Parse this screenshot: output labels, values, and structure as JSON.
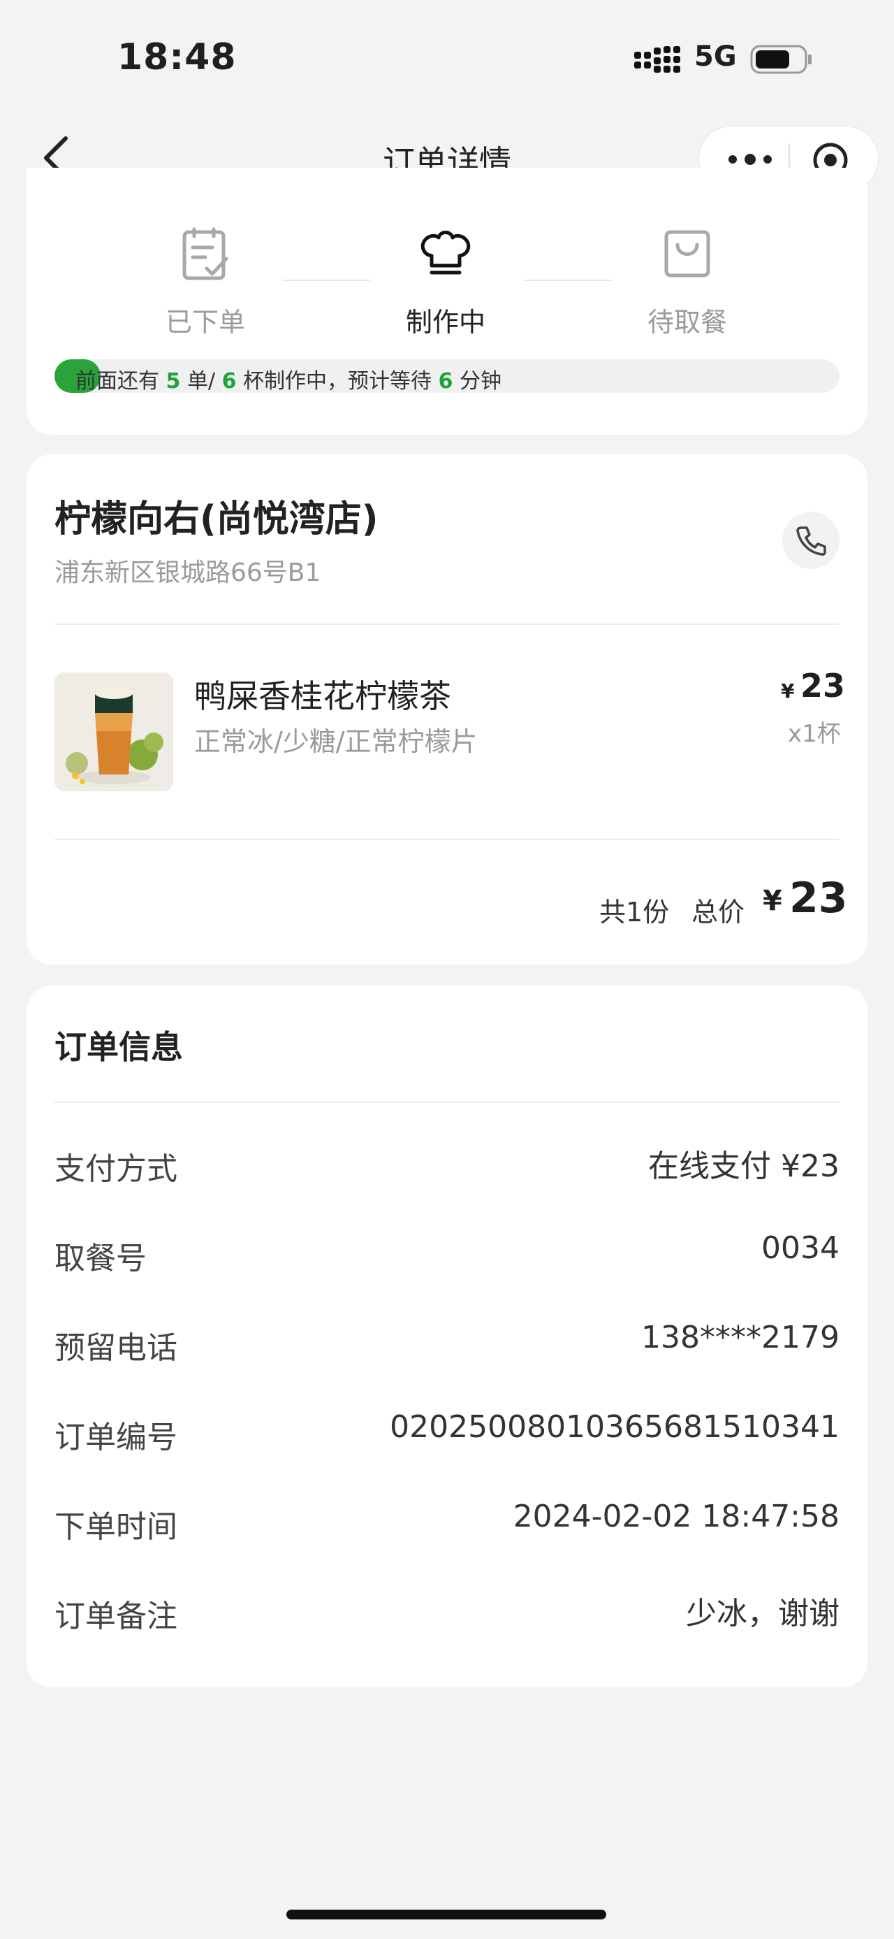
{
  "status_bar": {
    "time": "18:48",
    "network": "5G"
  },
  "nav": {
    "title": "订单详情"
  },
  "progress": {
    "steps": [
      {
        "label": "已下单",
        "icon": "clipboard-check-icon"
      },
      {
        "label": "制作中",
        "icon": "chef-hat-icon",
        "active": true
      },
      {
        "label": "待取餐",
        "icon": "shopping-bag-icon"
      }
    ],
    "wait": {
      "prefix": "前面还有",
      "orders": "5",
      "orders_unit": "单/",
      "cups": "6",
      "cups_unit": "杯制作中，预计等待",
      "minutes": "6",
      "minutes_unit": "分钟"
    },
    "accent": "#1ea33a"
  },
  "store": {
    "name": "柠檬向右(尚悦湾店)",
    "address": "浦东新区银城路66号B1"
  },
  "item": {
    "name": "鸭屎香桂花柠檬茶",
    "spec": "正常冰/少糖/正常柠檬片",
    "currency": "¥",
    "price": "23",
    "quantity": "x1杯"
  },
  "summary": {
    "count": "共1份",
    "total_label": "总价",
    "currency": "¥",
    "total": "23"
  },
  "order_info": {
    "title": "订单信息",
    "rows": [
      {
        "label": "支付方式",
        "value": "在线支付 ¥23"
      },
      {
        "label": "取餐号",
        "value": "0034"
      },
      {
        "label": "预留电话",
        "value": "138****2179"
      },
      {
        "label": "订单编号",
        "value": "020250080103656815103​41"
      },
      {
        "label": "下单时间",
        "value": "2024-02-02 18:47:58"
      },
      {
        "label": "订单备注",
        "value": "少冰，谢谢"
      }
    ]
  }
}
